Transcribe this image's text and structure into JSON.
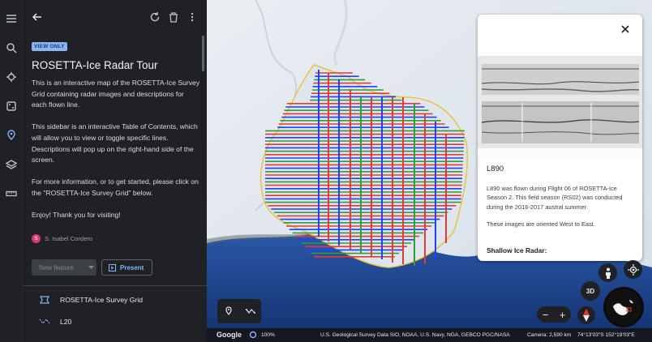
{
  "sidebar": {
    "badge": "VIEW ONLY",
    "title": "ROSETTA-Ice Radar Tour",
    "description": [
      "This is an interactive map of the ROSETTA-Ice Survey Grid containing radar images and descriptions for each flown line.",
      "This sidebar is an interactive Table of Contents, which will allow you to view or toggle specific lines. Descriptions will pop up on the right-hand side of the screen.",
      "For more information, or to get started, please click on the \"ROSETTA-Ice Survey Grid\" below.",
      "Enjoy! Thank you for visiting!"
    ],
    "author_initial": "S",
    "author": "S. Isabel Cordero",
    "new_feature_label": "New feature",
    "present_label": "Present",
    "toc": [
      {
        "label": "ROSETTA-Ice Survey Grid",
        "icon": "polygon-icon"
      },
      {
        "label": "L20",
        "icon": "path-icon"
      }
    ]
  },
  "popup": {
    "title": "L890",
    "body": [
      "L890 was flown during Flight 06 of ROSETTA-Ice Season 2. This field season (RS02) was conducted during the 2016-2017 austral summer.",
      "These images are oriented West to East."
    ],
    "subheading": "Shallow Ice Radar:"
  },
  "map": {
    "navigation_3d_label": "3D",
    "zoom_out": "−",
    "zoom_in": "+"
  },
  "status_bar": {
    "brand": "Google",
    "zoom_percent": "100%",
    "attribution": "U.S. Geological Survey  Data SIO, NOAA, U.S. Navy, NGA, GEBCO  PGC/NASA",
    "camera": "Camera: 2,590 km",
    "coordinates": "74°13'03\"S 152°19'03\"E"
  },
  "colors": {
    "accent": "#8ab4f8",
    "red_line": "#e53935",
    "blue_line": "#1e40ff",
    "green_line": "#2e9d3a",
    "outline": "#e8c347"
  }
}
